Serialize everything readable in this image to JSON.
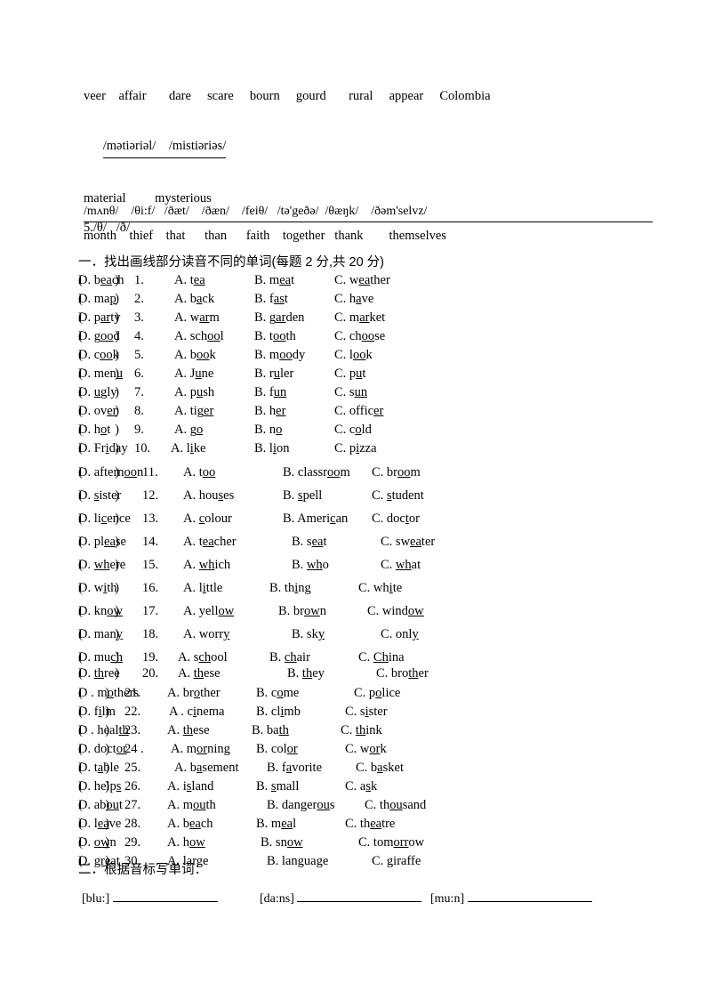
{
  "header": {
    "word_row": "veer    affair       dare     scare     bourn     gourd       rural     appear     Colombia",
    "phonetic_row": "/mətiəriəl/    /mistiəriəs/",
    "word_row2": "material         mysterious",
    "rule_label": "5./θ/   /ð/"
  },
  "phonetic_table": {
    "symbols": "/mʌnθ/    /θi:f/   /ðæt/    /ðæn/    /feiθ/   /tə'geðə/  /θæŋk/    /ðəm'selvz/",
    "words": "month    thief    that      than      faith    together   thank        themselves"
  },
  "section_one": {
    "heading": "一．找出画线部分读音不同的单词(每题 2 分,共 20 分)",
    "questions": [
      {
        "num": "1.",
        "paren": "(          )",
        "options": [
          {
            "label": "A.",
            "pre": "t",
            "mid": "ea",
            "post": ""
          },
          {
            "label": "B.",
            "pre": "m",
            "mid": "ea",
            "post": "t"
          },
          {
            "label": "C.",
            "pre": "w",
            "mid": "ea",
            "post": "ther"
          },
          {
            "label": "D.",
            "pre": "b",
            "mid": "ea",
            "post": "ch"
          }
        ]
      },
      {
        "num": "2.",
        "paren": "(          )",
        "options": [
          {
            "label": "A.",
            "pre": "b",
            "mid": "a",
            "post": "ck"
          },
          {
            "label": "B.",
            "pre": "f",
            "mid": "as",
            "post": "t"
          },
          {
            "label": "C.",
            "pre": "h",
            "mid": "a",
            "post": "ve"
          },
          {
            "label": "D.",
            "pre": "ma",
            "mid": "p",
            "post": ""
          }
        ]
      },
      {
        "num": "3.",
        "paren": "(          )",
        "options": [
          {
            "label": "A.",
            "pre": "w",
            "mid": "ar",
            "post": "m"
          },
          {
            "label": "B.",
            "pre": "g",
            "mid": "ar",
            "post": "den"
          },
          {
            "label": "C.",
            "pre": "m",
            "mid": "ar",
            "post": "ket"
          },
          {
            "label": "D.",
            "pre": "p",
            "mid": "ar",
            "post": "ty"
          }
        ]
      },
      {
        "num": "4.",
        "paren": "(          )",
        "options": [
          {
            "label": "A.",
            "pre": "sch",
            "mid": "oo",
            "post": "l"
          },
          {
            "label": "B.",
            "pre": "t",
            "mid": "oo",
            "post": "th"
          },
          {
            "label": "C.",
            "pre": "ch",
            "mid": "oo",
            "post": "se"
          },
          {
            "label": "D.",
            "pre": "g",
            "mid": "oo",
            "post": "d"
          }
        ]
      },
      {
        "num": "5.",
        "paren": "(          )",
        "options": [
          {
            "label": "A.",
            "pre": "b",
            "mid": "oo",
            "post": "k"
          },
          {
            "label": "B.",
            "pre": "m",
            "mid": "oo",
            "post": "dy"
          },
          {
            "label": "C.",
            "pre": "l",
            "mid": "oo",
            "post": "k"
          },
          {
            "label": "D.",
            "pre": "c",
            "mid": "oo",
            "post": "k"
          }
        ]
      },
      {
        "num": "6.",
        "paren": "(          )",
        "options": [
          {
            "label": "A.",
            "pre": "J",
            "mid": "u",
            "post": "ne"
          },
          {
            "label": "B.",
            "pre": "r",
            "mid": "u",
            "post": "ler"
          },
          {
            "label": "C.",
            "pre": "p",
            "mid": "u",
            "post": "t"
          },
          {
            "label": "D.",
            "pre": "men",
            "mid": "u",
            "post": ""
          }
        ]
      },
      {
        "num": "7.",
        "paren": "(          )",
        "options": [
          {
            "label": "A.",
            "pre": "p",
            "mid": "u",
            "post": "sh"
          },
          {
            "label": "B.",
            "pre": "f",
            "mid": "un",
            "post": ""
          },
          {
            "label": "C.",
            "pre": "s",
            "mid": "un",
            "post": ""
          },
          {
            "label": "D.",
            "pre": "",
            "mid": "u",
            "post": "gly"
          }
        ]
      },
      {
        "num": "8.",
        "paren": "(          )",
        "options": [
          {
            "label": "A.",
            "pre": "tig",
            "mid": "er",
            "post": ""
          },
          {
            "label": "B.",
            "pre": "h",
            "mid": "er",
            "post": ""
          },
          {
            "label": "C.",
            "pre": "offic",
            "mid": "er",
            "post": ""
          },
          {
            "label": "D.",
            "pre": "ov",
            "mid": "er",
            "post": ""
          }
        ]
      },
      {
        "num": "9.",
        "paren": "(          )",
        "options": [
          {
            "label": "A.",
            "pre": "g",
            "mid": "o",
            "post": ""
          },
          {
            "label": "B.",
            "pre": "n",
            "mid": "o",
            "post": ""
          },
          {
            "label": "C.",
            "pre": "c",
            "mid": "o",
            "post": "ld"
          },
          {
            "label": "D.",
            "pre": "h",
            "mid": "o",
            "post": "t"
          }
        ]
      },
      {
        "num": "10.",
        "paren": "(          )",
        "options": [
          {
            "label": "A.",
            "pre": "l",
            "mid": "i",
            "post": "ke"
          },
          {
            "label": "B.",
            "pre": "l",
            "mid": "i",
            "post": "on"
          },
          {
            "label": "C.",
            "pre": "p",
            "mid": "i",
            "post": "zza"
          },
          {
            "label": "D.",
            "pre": "Fr",
            "mid": "i",
            "post": "day"
          }
        ]
      },
      {
        "num": "11.",
        "paren": "(          )",
        "options": [
          {
            "label": "A.",
            "pre": "t",
            "mid": "oo",
            "post": ""
          },
          {
            "label": "B.",
            "pre": "classr",
            "mid": "oo",
            "post": "m"
          },
          {
            "label": "C.",
            "pre": "br",
            "mid": "oo",
            "post": "m"
          },
          {
            "label": "D.",
            "pre": "aftern",
            "mid": "oo",
            "post": "n"
          }
        ]
      },
      {
        "num": "12.",
        "paren": "(          )",
        "options": [
          {
            "label": "A.",
            "pre": "hou",
            "mid": "s",
            "post": "es"
          },
          {
            "label": "B.",
            "pre": "",
            "mid": "s",
            "post": "pell"
          },
          {
            "label": "C.",
            "pre": "",
            "mid": "s",
            "post": "tudent"
          },
          {
            "label": "D.",
            "pre": "",
            "mid": "s",
            "post": "ister"
          }
        ]
      },
      {
        "num": "13.",
        "paren": "(          )",
        "options": [
          {
            "label": "A.",
            "pre": "",
            "mid": "c",
            "post": "olour"
          },
          {
            "label": "B.",
            "pre": "Ameri",
            "mid": "c",
            "post": "an"
          },
          {
            "label": "C.",
            "pre": "doc",
            "mid": "t",
            "post": "or"
          },
          {
            "label": "D.",
            "pre": "li",
            "mid": "c",
            "post": "ence"
          }
        ]
      },
      {
        "num": "14.",
        "paren": "(          )",
        "options": [
          {
            "label": "A.",
            "pre": "t",
            "mid": "ea",
            "post": "cher"
          },
          {
            "label": "B.",
            "pre": "s",
            "mid": "ea",
            "post": "t"
          },
          {
            "label": "C.",
            "pre": "sw",
            "mid": "ea",
            "post": "ter"
          },
          {
            "label": "D.",
            "pre": "pl",
            "mid": "ea",
            "post": "se"
          }
        ]
      },
      {
        "num": "15.",
        "paren": "(          )",
        "options": [
          {
            "label": "A.",
            "pre": "",
            "mid": "wh",
            "post": "ich"
          },
          {
            "label": "B.",
            "pre": "",
            "mid": "wh",
            "post": "o"
          },
          {
            "label": "C.",
            "pre": "",
            "mid": "wh",
            "post": "at"
          },
          {
            "label": "D.",
            "pre": "",
            "mid": "wh",
            "post": "ere"
          }
        ]
      },
      {
        "num": "16.",
        "paren": "(          )",
        "options": [
          {
            "label": "A.",
            "pre": "l",
            "mid": "i",
            "post": "ttle"
          },
          {
            "label": "B.",
            "pre": "th",
            "mid": "i",
            "post": "ng"
          },
          {
            "label": "C.",
            "pre": "wh",
            "mid": "i",
            "post": "te"
          },
          {
            "label": "D.",
            "pre": "w",
            "mid": "i",
            "post": "th"
          }
        ]
      },
      {
        "num": "17.",
        "paren": "(          )",
        "options": [
          {
            "label": "A.",
            "pre": "yell",
            "mid": "ow",
            "post": ""
          },
          {
            "label": "B.",
            "pre": "br",
            "mid": "ow",
            "post": "n"
          },
          {
            "label": "C.",
            "pre": "wind",
            "mid": "ow",
            "post": ""
          },
          {
            "label": "D.",
            "pre": "kn",
            "mid": "ow",
            "post": ""
          }
        ]
      },
      {
        "num": "18.",
        "paren": "(          )",
        "options": [
          {
            "label": "A.",
            "pre": "worr",
            "mid": "y",
            "post": ""
          },
          {
            "label": "B.",
            "pre": "sk",
            "mid": "y",
            "post": ""
          },
          {
            "label": "C.",
            "pre": "onl",
            "mid": "y",
            "post": ""
          },
          {
            "label": "D.",
            "pre": "man",
            "mid": "y",
            "post": ""
          }
        ]
      },
      {
        "num": "19.",
        "paren": "(          )",
        "options": [
          {
            "label": "A.",
            "pre": "s",
            "mid": "ch",
            "post": "ool"
          },
          {
            "label": "B.",
            "pre": "",
            "mid": "ch",
            "post": "air"
          },
          {
            "label": "C.",
            "pre": "",
            "mid": "Ch",
            "post": "ina"
          },
          {
            "label": "D.",
            "pre": "mu",
            "mid": "ch",
            "post": ""
          }
        ]
      },
      {
        "num": "20.",
        "paren": "(          )",
        "options": [
          {
            "label": "A.",
            "pre": "",
            "mid": "th",
            "post": "ese"
          },
          {
            "label": "B.",
            "pre": "",
            "mid": "th",
            "post": "ey"
          },
          {
            "label": "C.",
            "pre": "bro",
            "mid": "th",
            "post": "er"
          },
          {
            "label": "D.",
            "pre": "",
            "mid": "th",
            "post": "ree"
          }
        ]
      },
      {
        "num": "21.",
        "paren": "(       )",
        "options": [
          {
            "label": "A.",
            "pre": "br",
            "mid": "o",
            "post": "ther"
          },
          {
            "label": "B.",
            "pre": "c",
            "mid": "o",
            "post": "me"
          },
          {
            "label": "C.",
            "pre": "p",
            "mid": "o",
            "post": "lice"
          },
          {
            "label": "D .",
            "pre": "m",
            "mid": "o",
            "post": "thers"
          }
        ]
      },
      {
        "num": "22.",
        "paren": "(       )",
        "options": [
          {
            "label": "A .",
            "pre": "c",
            "mid": "i",
            "post": "nema"
          },
          {
            "label": "B.",
            "pre": "cl",
            "mid": "i",
            "post": "mb"
          },
          {
            "label": "C.",
            "pre": "s",
            "mid": "i",
            "post": "ster"
          },
          {
            "label": "D.",
            "pre": "f",
            "mid": "i",
            "post": "lm"
          }
        ]
      },
      {
        "num": "23.",
        "paren": "(       )",
        "options": [
          {
            "label": "A.",
            "pre": "",
            "mid": "th",
            "post": "ese"
          },
          {
            "label": "B.",
            "pre": "ba",
            "mid": "th",
            "post": ""
          },
          {
            "label": "C.",
            "pre": "",
            "mid": "th",
            "post": "ink"
          },
          {
            "label": "D .",
            "pre": "heal",
            "mid": "th",
            "post": ""
          }
        ]
      },
      {
        "num": "24 .",
        "paren": "(       )",
        "options": [
          {
            "label": "A.",
            "pre": "m",
            "mid": "or",
            "post": "ning"
          },
          {
            "label": "B.",
            "pre": "col",
            "mid": "or",
            "post": ""
          },
          {
            "label": "C.",
            "pre": "w",
            "mid": "or",
            "post": "k"
          },
          {
            "label": "D.",
            "pre": "doct",
            "mid": "or",
            "post": ""
          }
        ]
      },
      {
        "num": "25.",
        "paren": "(       )",
        "options": [
          {
            "label": "A.",
            "pre": "b",
            "mid": "a",
            "post": "sement"
          },
          {
            "label": "B.",
            "pre": "f",
            "mid": "a",
            "post": "vorite"
          },
          {
            "label": "C.",
            "pre": "b",
            "mid": "a",
            "post": "sket"
          },
          {
            "label": "D.",
            "pre": "t",
            "mid": "a",
            "post": "ble"
          }
        ]
      },
      {
        "num": "26.",
        "paren": "(       )",
        "options": [
          {
            "label": "A.",
            "pre": "i",
            "mid": "s",
            "post": "land"
          },
          {
            "label": "B.",
            "pre": "",
            "mid": "s",
            "post": "mall"
          },
          {
            "label": "C.",
            "pre": "a",
            "mid": "s",
            "post": "k"
          },
          {
            "label": "D.",
            "pre": "help",
            "mid": "s",
            "post": ""
          }
        ]
      },
      {
        "num": "27.",
        "paren": "(       )",
        "options": [
          {
            "label": "A.",
            "pre": "m",
            "mid": "ou",
            "post": "th"
          },
          {
            "label": "B.",
            "pre": "danger",
            "mid": "ou",
            "post": "s"
          },
          {
            "label": "C.",
            "pre": "th",
            "mid": "ou",
            "post": "sand"
          },
          {
            "label": "D.",
            "pre": "ab",
            "mid": "ou",
            "post": "t"
          }
        ]
      },
      {
        "num": "28.",
        "paren": "(       )",
        "options": [
          {
            "label": "A.",
            "pre": "b",
            "mid": "ea",
            "post": "ch"
          },
          {
            "label": "B.",
            "pre": "m",
            "mid": "ea",
            "post": "l"
          },
          {
            "label": "C.",
            "pre": "th",
            "mid": "ea",
            "post": "tre"
          },
          {
            "label": "D.",
            "pre": "l",
            "mid": "ea",
            "post": "ve"
          }
        ]
      },
      {
        "num": "29.",
        "paren": "(       )",
        "options": [
          {
            "label": "A.",
            "pre": "h",
            "mid": "ow",
            "post": ""
          },
          {
            "label": "B.",
            "pre": "sn",
            "mid": "ow",
            "post": ""
          },
          {
            "label": "C.",
            "pre": "tom",
            "mid": "orr",
            "post": "ow"
          },
          {
            "label": "D.",
            "pre": "",
            "mid": "ow",
            "post": "n"
          }
        ]
      },
      {
        "num": "30.",
        "paren": "(       )",
        "options": [
          {
            "label": "A.",
            "pre": "lar",
            "mid": "g",
            "post": "e"
          },
          {
            "label": "B.",
            "pre": "langua",
            "mid": "g",
            "post": "e"
          },
          {
            "label": "C.",
            "pre": "",
            "mid": "g",
            "post": "iraffe"
          },
          {
            "label": "D.",
            "pre": "",
            "mid": "gr",
            "post": "eat"
          }
        ]
      }
    ]
  },
  "section_two": {
    "heading": "二．根据音标写单词：",
    "items": [
      {
        "ipa": "[blu:]"
      },
      {
        "ipa": "[da:ns]"
      },
      {
        "ipa": "[mu:n]"
      }
    ]
  }
}
